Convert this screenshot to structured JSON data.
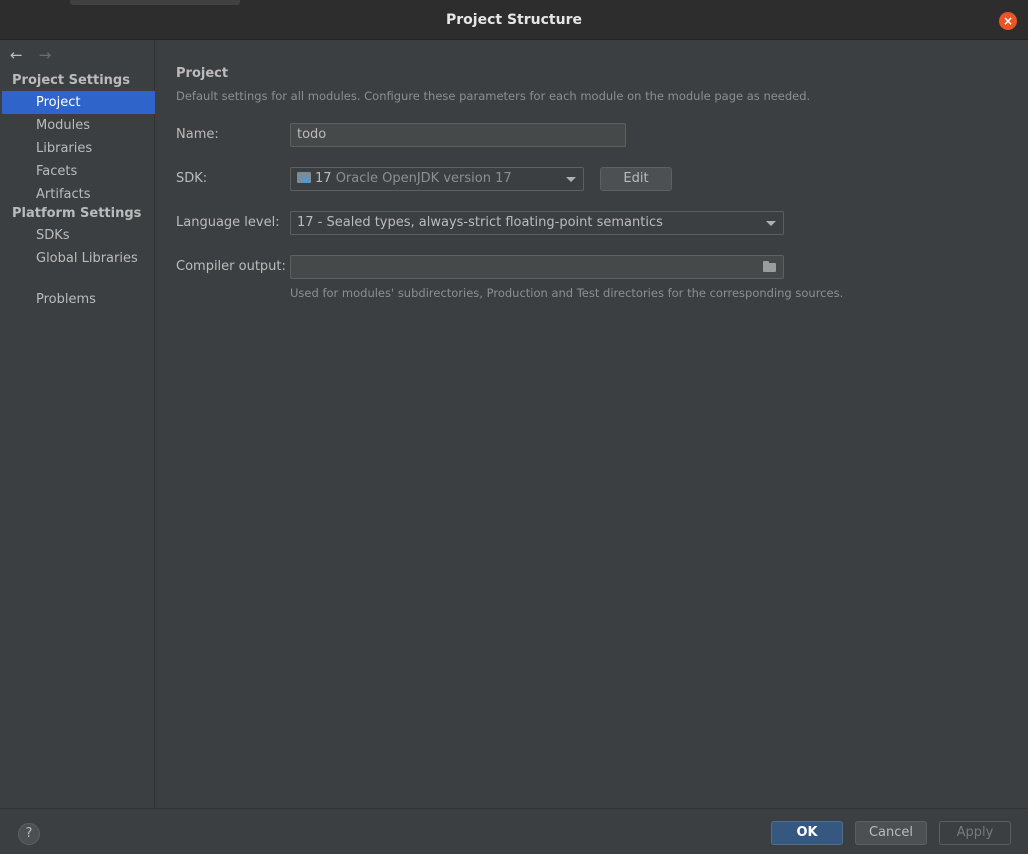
{
  "window": {
    "title": "Project Structure",
    "close_glyph": "×",
    "accent_close": "#e85526"
  },
  "nav": {
    "back_glyph": "←",
    "forward_glyph": "→"
  },
  "sidebar": {
    "project_settings_header": "Project Settings",
    "project_settings_items": [
      "Project",
      "Modules",
      "Libraries",
      "Facets",
      "Artifacts"
    ],
    "platform_settings_header": "Platform Settings",
    "platform_settings_items": [
      "SDKs",
      "Global Libraries"
    ],
    "problems": "Problems",
    "selected": "Project",
    "selection_color": "#2f65ca"
  },
  "main": {
    "title": "Project",
    "description": "Default settings for all modules. Configure these parameters for each module on the module page as needed.",
    "name_label": "Name:",
    "name_value": "todo",
    "sdk_label": "SDK:",
    "sdk_version": "17",
    "sdk_name": "Oracle OpenJDK version 17",
    "sdk_icon": "folder-sdk-icon",
    "edit_label": "Edit",
    "language_level_label": "Language level:",
    "language_level_value": "17 - Sealed types, always-strict floating-point semantics",
    "compiler_output_label": "Compiler output:",
    "compiler_output_value": "",
    "compiler_output_hint": "Used for modules' subdirectories, Production and Test directories for the corresponding sources."
  },
  "footer": {
    "help_glyph": "?",
    "ok_label": "OK",
    "cancel_label": "Cancel",
    "apply_label": "Apply",
    "ok_color": "#365880"
  }
}
